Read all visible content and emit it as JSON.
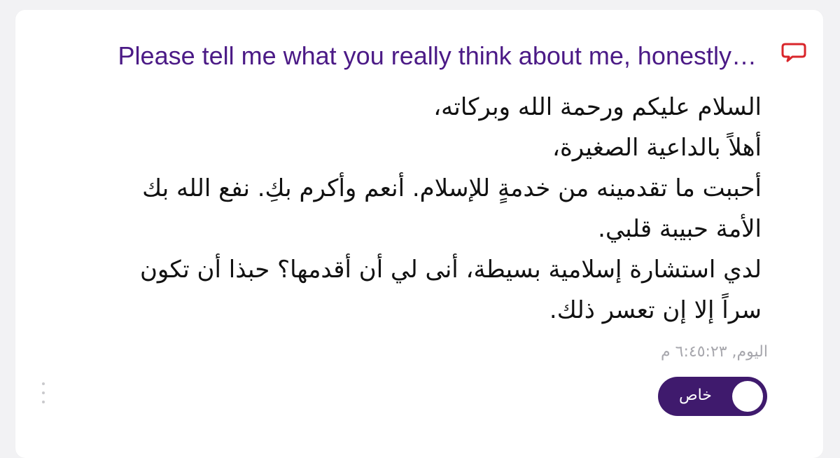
{
  "question": {
    "text": "Please tell me what you really think about me, honestly…",
    "icon": "chat-bubble-icon"
  },
  "answer": {
    "lines": [
      "السلام عليكم ورحمة الله وبركاته،",
      "أهلاً بالداعية الصغيرة،",
      "أحببت ما تقدمينه من خدمةٍ للإسلام. أنعم وأكرم بكِ. نفع الله بك",
      "الأمة حبيبة قلبي.",
      "لدي استشارة إسلامية بسيطة، أنى لي أن أقدمها؟ حبذا أن تكون",
      "سراً إلا إن تعسر ذلك."
    ]
  },
  "timestamp": "اليوم, ٦:٤٥:٢٣ م",
  "toggle": {
    "label": "خاص",
    "state": "on"
  },
  "colors": {
    "accent": "#4b1a86",
    "toggle_bg": "#3f1a6d",
    "icon_red": "#d9262b",
    "timestamp": "#a7a7ad"
  }
}
